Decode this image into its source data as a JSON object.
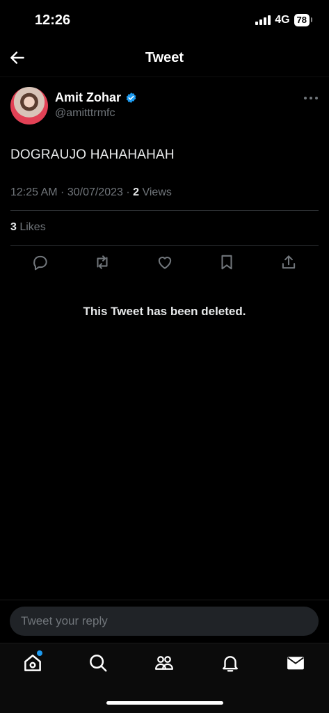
{
  "status_bar": {
    "time": "12:26",
    "network": "4G",
    "battery": "78"
  },
  "header": {
    "title": "Tweet"
  },
  "tweet": {
    "author_name": "Amit Zohar",
    "handle": "@amitttrmfc",
    "text": "DOGRAUJO HAHAHAHAH",
    "timestamp": "12:25 AM · 30/07/2023 · ",
    "views_count": "2",
    "views_label": " Views",
    "likes_count": "3",
    "likes_label": " Likes",
    "verified": true
  },
  "deleted_notice": "This Tweet has been deleted.",
  "reply": {
    "placeholder": "Tweet your reply"
  },
  "tabs": [
    "home-icon",
    "search-icon",
    "communities-icon",
    "notifications-icon",
    "messages-icon"
  ],
  "colors": {
    "accent": "#1d9bf0",
    "muted": "#71767b",
    "text": "#e7e9ea",
    "background": "#000000"
  }
}
